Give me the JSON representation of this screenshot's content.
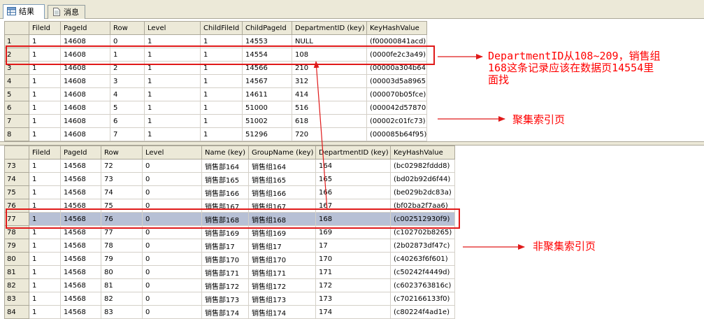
{
  "tabs": [
    {
      "label": "结果",
      "icon": "grid-icon"
    },
    {
      "label": "消息",
      "icon": "document-icon"
    }
  ],
  "grid1": {
    "columns": [
      "FileId",
      "PageId",
      "Row",
      "Level",
      "ChildFileId",
      "ChildPageId",
      "DepartmentID (key)",
      "KeyHashValue"
    ],
    "rows": [
      [
        "1",
        "1",
        "14608",
        "0",
        "1",
        "1",
        "14553",
        "NULL",
        "(f00000841acd)"
      ],
      [
        "2",
        "1",
        "14608",
        "1",
        "1",
        "1",
        "14554",
        "108",
        "(0000fe2c3a49)"
      ],
      [
        "3",
        "1",
        "14608",
        "2",
        "1",
        "1",
        "14566",
        "210",
        "(00000a304b64)"
      ],
      [
        "4",
        "1",
        "14608",
        "3",
        "1",
        "1",
        "14567",
        "312",
        "(00003d5a8965)"
      ],
      [
        "5",
        "1",
        "14608",
        "4",
        "1",
        "1",
        "14611",
        "414",
        "(000070b05fce)"
      ],
      [
        "6",
        "1",
        "14608",
        "5",
        "1",
        "1",
        "51000",
        "516",
        "(000042d57870)"
      ],
      [
        "7",
        "1",
        "14608",
        "6",
        "1",
        "1",
        "51002",
        "618",
        "(00002c01fc73)"
      ],
      [
        "8",
        "1",
        "14608",
        "7",
        "1",
        "1",
        "51296",
        "720",
        "(000085b64f95)"
      ]
    ]
  },
  "grid2": {
    "columns": [
      "FileId",
      "PageId",
      "Row",
      "Level",
      "Name (key)",
      "GroupName (key)",
      "DepartmentID (key)",
      "KeyHashValue"
    ],
    "rows": [
      [
        "73",
        "1",
        "14568",
        "72",
        "0",
        "销售部164",
        "销售组164",
        "164",
        "(bc02982fddd8)"
      ],
      [
        "74",
        "1",
        "14568",
        "73",
        "0",
        "销售部165",
        "销售组165",
        "165",
        "(bd02b92d6f44)"
      ],
      [
        "75",
        "1",
        "14568",
        "74",
        "0",
        "销售部166",
        "销售组166",
        "166",
        "(be029b2dc83a)"
      ],
      [
        "76",
        "1",
        "14568",
        "75",
        "0",
        "销售部167",
        "销售组167",
        "167",
        "(bf02ba2f7aa6)"
      ],
      [
        "77",
        "1",
        "14568",
        "76",
        "0",
        "销售部168",
        "销售组168",
        "168",
        "(c002512930f9)"
      ],
      [
        "78",
        "1",
        "14568",
        "77",
        "0",
        "销售部169",
        "销售组169",
        "169",
        "(c102702b8265)"
      ],
      [
        "79",
        "1",
        "14568",
        "78",
        "0",
        "销售部17",
        "销售组17",
        "17",
        "(2b02873df47c)"
      ],
      [
        "80",
        "1",
        "14568",
        "79",
        "0",
        "销售部170",
        "销售组170",
        "170",
        "(c40263f6f601)"
      ],
      [
        "81",
        "1",
        "14568",
        "80",
        "0",
        "销售部171",
        "销售组171",
        "171",
        "(c50242f4449d)"
      ],
      [
        "82",
        "1",
        "14568",
        "81",
        "0",
        "销售部172",
        "销售组172",
        "172",
        "(c6023763816c)"
      ],
      [
        "83",
        "1",
        "14568",
        "82",
        "0",
        "销售部173",
        "销售组173",
        "173",
        "(c702166133f0)"
      ],
      [
        "84",
        "1",
        "14568",
        "83",
        "0",
        "销售部174",
        "销售组174",
        "174",
        "(c80224f4ad1e)"
      ]
    ],
    "selected_row": "77"
  },
  "annotations": {
    "note_line1": "DepartmentID从108~209，销售组",
    "note_line2": "168这条记录应该在数据页14554里",
    "note_line3": "面找",
    "clustered_label": "聚集索引页",
    "nonclustered_label": "非聚集索引页",
    "color": "#ff0000"
  },
  "colors": {
    "selection": "#b7c0d5",
    "header_bg": "#ece9d8",
    "highlight_border": "#e01a1a"
  }
}
